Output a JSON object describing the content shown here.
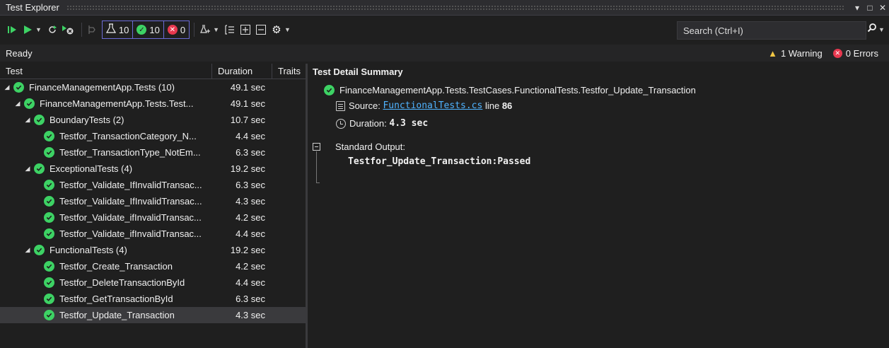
{
  "window": {
    "title": "Test Explorer",
    "controls": [
      "▾",
      "□",
      "✕"
    ]
  },
  "toolbar": {
    "counters": {
      "total": "10",
      "passed": "10",
      "failed": "0"
    },
    "search": {
      "placeholder": "Search (Ctrl+I)"
    }
  },
  "status": {
    "text": "Ready",
    "warnings": "1 Warning",
    "errors": "0 Errors"
  },
  "tree": {
    "columns": {
      "test": "Test",
      "duration": "Duration",
      "traits": "Traits"
    },
    "rows": [
      {
        "name": "FinanceManagementApp.Tests (10)",
        "duration": "49.1 sec",
        "level": 0,
        "expandable": true,
        "selected": false
      },
      {
        "name": "FinanceManagementApp.Tests.Test...",
        "duration": "49.1 sec",
        "level": 1,
        "expandable": true,
        "selected": false
      },
      {
        "name": "BoundaryTests (2)",
        "duration": "10.7 sec",
        "level": 2,
        "expandable": true,
        "selected": false
      },
      {
        "name": "Testfor_TransactionCategory_N...",
        "duration": "4.4 sec",
        "level": 3,
        "expandable": false,
        "selected": false
      },
      {
        "name": "Testfor_TransactionType_NotEm...",
        "duration": "6.3 sec",
        "level": 3,
        "expandable": false,
        "selected": false
      },
      {
        "name": "ExceptionalTests (4)",
        "duration": "19.2 sec",
        "level": 2,
        "expandable": true,
        "selected": false
      },
      {
        "name": "Testfor_Validate_IfInvalidTransac...",
        "duration": "6.3 sec",
        "level": 3,
        "expandable": false,
        "selected": false
      },
      {
        "name": "Testfor_Validate_IfInvalidTransac...",
        "duration": "4.3 sec",
        "level": 3,
        "expandable": false,
        "selected": false
      },
      {
        "name": "Testfor_Validate_ifInvalidTransac...",
        "duration": "4.2 sec",
        "level": 3,
        "expandable": false,
        "selected": false
      },
      {
        "name": "Testfor_Validate_ifInvalidTransac...",
        "duration": "4.4 sec",
        "level": 3,
        "expandable": false,
        "selected": false
      },
      {
        "name": "FunctionalTests (4)",
        "duration": "19.2 sec",
        "level": 2,
        "expandable": true,
        "selected": false
      },
      {
        "name": "Testfor_Create_Transaction",
        "duration": "4.2 sec",
        "level": 3,
        "expandable": false,
        "selected": false
      },
      {
        "name": "Testfor_DeleteTransactionById",
        "duration": "4.4 sec",
        "level": 3,
        "expandable": false,
        "selected": false
      },
      {
        "name": "Testfor_GetTransactionById",
        "duration": "6.3 sec",
        "level": 3,
        "expandable": false,
        "selected": false
      },
      {
        "name": "Testfor_Update_Transaction",
        "duration": "4.3 sec",
        "level": 3,
        "expandable": false,
        "selected": true
      }
    ]
  },
  "detail": {
    "heading": "Test Detail Summary",
    "test_name": "FinanceManagementApp.Tests.TestCases.FunctionalTests.Testfor_Update_Transaction",
    "source_label": "Source:",
    "source_file": "FunctionalTests.cs",
    "line_label": "line",
    "line_number": "86",
    "duration_label": "Duration:",
    "duration_value": "4.3 sec",
    "stdout_label": "Standard Output:",
    "stdout_text": "Testfor_Update_Transaction:Passed"
  },
  "colors": {
    "pass": "#3dd264",
    "fail": "#e8384f",
    "warning": "#f2c744",
    "link": "#4fb3ff",
    "counter_border": "#6b6bd6"
  }
}
